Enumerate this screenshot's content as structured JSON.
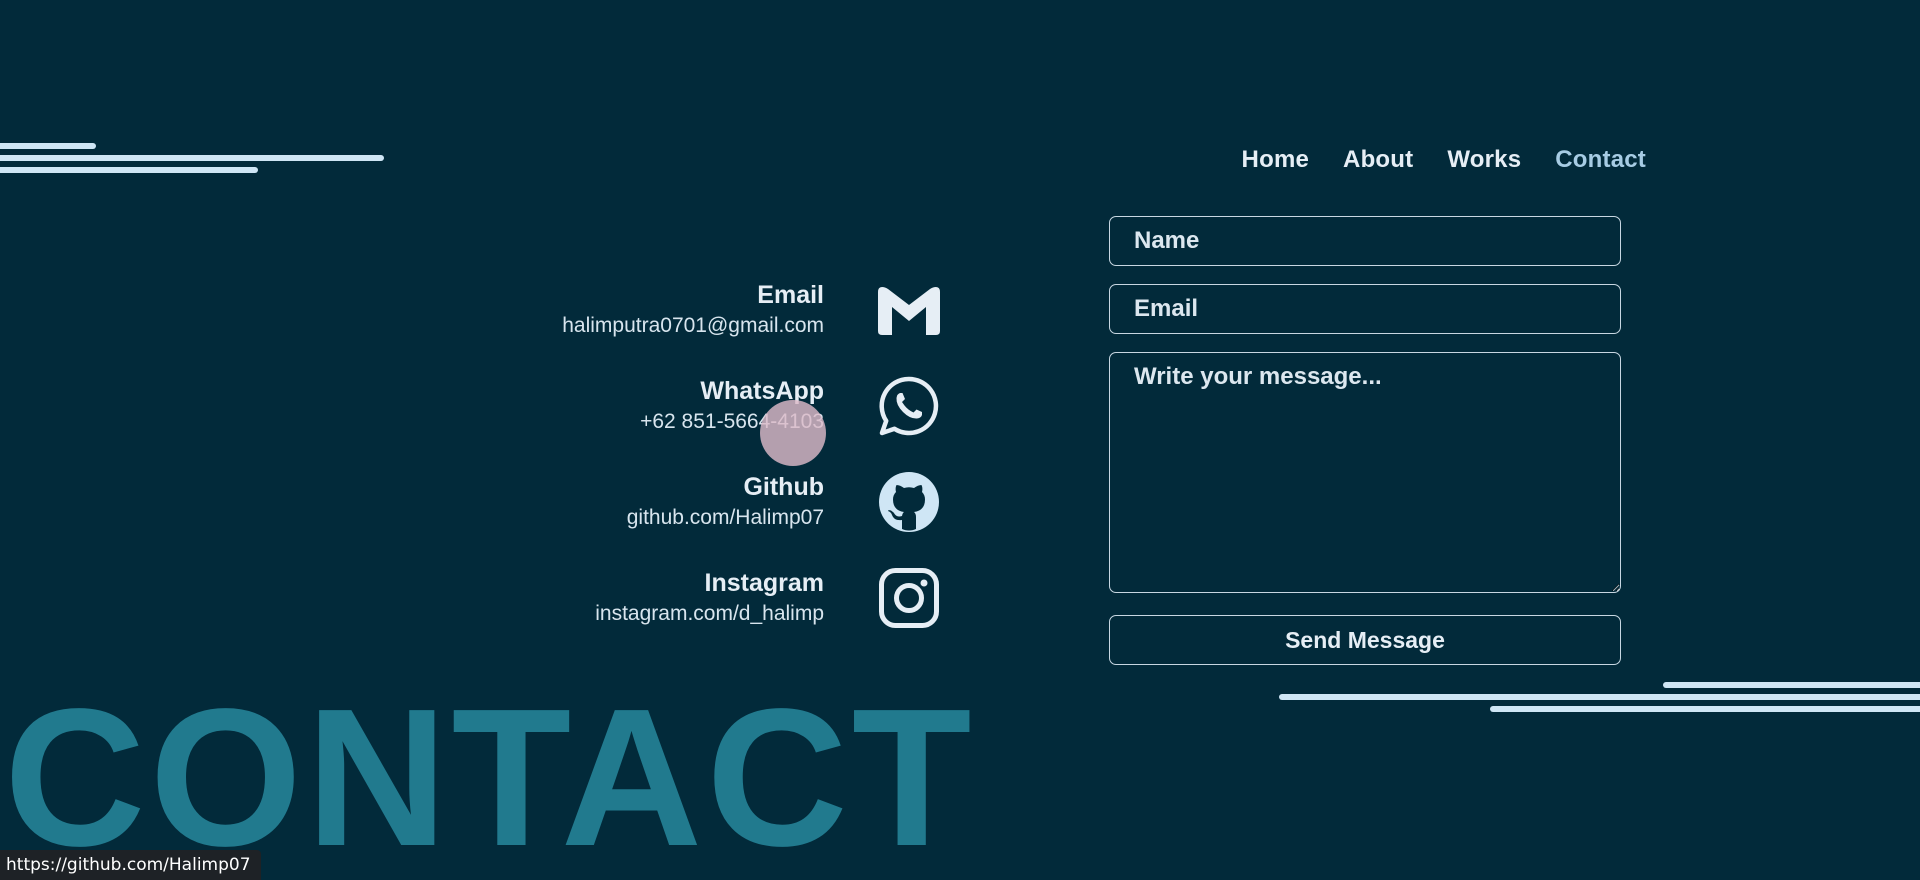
{
  "nav": {
    "items": [
      {
        "label": "Home"
      },
      {
        "label": "About"
      },
      {
        "label": "Works"
      },
      {
        "label": "Contact"
      }
    ],
    "active_color": "#A7CCE4"
  },
  "contacts": [
    {
      "title": "Email",
      "value": "halimputra0701@gmail.com",
      "icon": "gmail-icon"
    },
    {
      "title": "WhatsApp",
      "value": "+62 851-5664-4103",
      "icon": "whatsapp-icon"
    },
    {
      "title": "Github",
      "value": "github.com/Halimp07",
      "icon": "github-icon"
    },
    {
      "title": "Instagram",
      "value": "instagram.com/d_halimp",
      "icon": "instagram-icon"
    }
  ],
  "form": {
    "name_placeholder": "Name",
    "email_placeholder": "Email",
    "message_placeholder": "Write your message...",
    "send_label": "Send Message"
  },
  "heading": {
    "text": "CONTACT",
    "color": "#217A8E"
  },
  "status_bar": {
    "url": "https://github.com/Halimp07"
  },
  "colors": {
    "background": "#022A3A",
    "text": "#E6EEF5",
    "lines": "#CFE6F5"
  }
}
